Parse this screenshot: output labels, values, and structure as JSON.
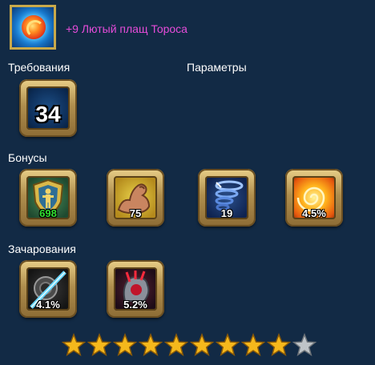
{
  "item": {
    "icon": "fire-orb-cloak-icon",
    "title": "+9 Лютый плащ Тороса"
  },
  "sections": {
    "requirements": "Требования",
    "parameters": "Параметры",
    "bonuses": "Бонусы",
    "enchantments": "Зачарования"
  },
  "requirements": [
    {
      "icon": "level-icon",
      "value": "34"
    }
  ],
  "bonuses": [
    {
      "icon": "shield-figure-icon",
      "value": "698",
      "value_color": "#30e030"
    },
    {
      "icon": "flexed-arm-icon",
      "value": "75"
    },
    {
      "icon": "whirlwind-icon",
      "value": "19"
    },
    {
      "icon": "fire-swirl-icon",
      "value": "4.5%"
    }
  ],
  "enchantments": [
    {
      "icon": "shield-slash-icon",
      "value": "4.1%"
    },
    {
      "icon": "red-claw-icon",
      "value": "5.2%"
    }
  ],
  "rating": {
    "filled": 9,
    "total": 10,
    "filled_color": "#f5b81c",
    "empty_color": "#bfc4c8"
  },
  "colors": {
    "background": "#122a45",
    "title": "#e64cd9",
    "frame_gold": "#c9a94a"
  }
}
